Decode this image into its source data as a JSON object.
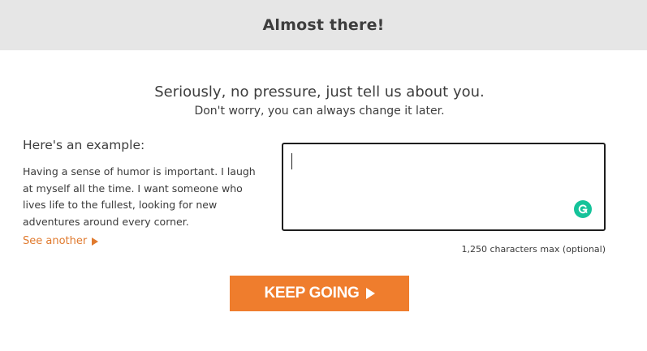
{
  "header": {
    "title": "Almost there!"
  },
  "main": {
    "headline": "Seriously, no pressure, just tell us about you.",
    "subheadline": "Don't worry, you can always change it later."
  },
  "example": {
    "label": "Here's an example:",
    "text": "Having a sense of humor is important. I laugh at myself all the time. I want someone who lives life to the fullest, looking for new adventures around every corner.",
    "see_another_label": "See another"
  },
  "about_input": {
    "value": "",
    "char_limit_text": "1,250 characters max (optional)",
    "assistant_icon": "grammarly-icon"
  },
  "cta": {
    "label": "KEEP GOING",
    "icon": "play-icon"
  },
  "colors": {
    "header_bg": "#e6e6e6",
    "accent": "#ef7d2d",
    "link": "#e07a2e",
    "grammarly": "#15c39a"
  }
}
